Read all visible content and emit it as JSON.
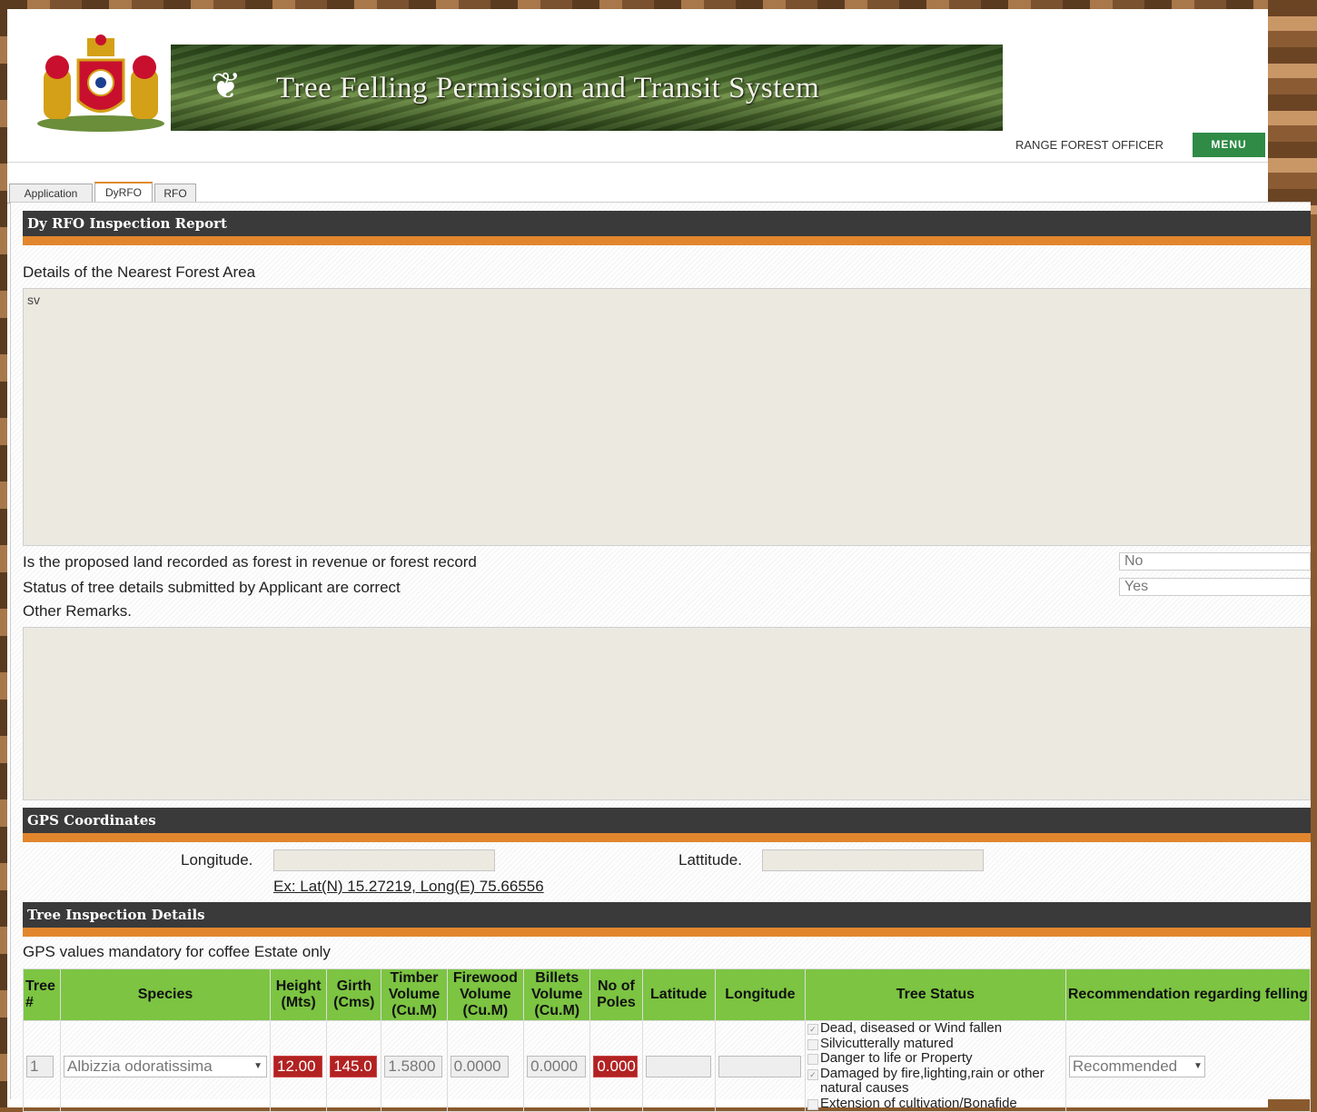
{
  "header": {
    "banner_title": "Tree Felling Permission and Transit System",
    "role": "RANGE FOREST OFFICER",
    "menu_label": "MENU"
  },
  "tabs": [
    {
      "label": "Application"
    },
    {
      "label": "DyRFO"
    },
    {
      "label": "RFO"
    }
  ],
  "inspection": {
    "section_title": "Dy RFO Inspection Report",
    "nearest_forest_label": "Details of the Nearest Forest Area",
    "nearest_forest_value": "sv",
    "land_recorded_label": "Is the proposed land recorded as forest in revenue or forest record",
    "land_recorded_value": "No",
    "tree_details_label": "Status of tree details submitted by Applicant are correct",
    "tree_details_value": "Yes",
    "other_remarks_label": "Other Remarks.",
    "other_remarks_value": ""
  },
  "gps": {
    "section_title": "GPS Coordinates",
    "longitude_label": "Longitude.",
    "latitude_label": "Lattitude.",
    "example": "Ex: Lat(N) 15.27219, Long(E) 75.66556"
  },
  "tree_inspection": {
    "section_title": "Tree Inspection Details",
    "note": "GPS values mandatory for coffee Estate only",
    "columns": {
      "tree_no": "Tree #",
      "species": "Species",
      "height": "Height (Mts)",
      "girth": "Girth (Cms)",
      "timber": "Timber Volume (Cu.M)",
      "firewood": "Firewood Volume (Cu.M)",
      "billets": "Billets Volume (Cu.M)",
      "poles": "No of Poles",
      "latitude": "Latitude",
      "longitude": "Longitude",
      "status": "Tree Status",
      "recommendation": "Recommendation regarding felling"
    },
    "rows": [
      {
        "tree_no": "1",
        "species": "Albizzia odoratissima",
        "height": "12.00",
        "girth": "145.0",
        "timber": "1.5800",
        "firewood": "0.0000",
        "billets": "0.0000",
        "poles": "0.000",
        "latitude": "",
        "longitude": "",
        "status_options": [
          {
            "label": "Dead, diseased or Wind fallen",
            "checked": true
          },
          {
            "label": "Silvicutterally matured",
            "checked": false
          },
          {
            "label": "Danger to life or Property",
            "checked": false
          },
          {
            "label": "Damaged by fire,lighting,rain or other natural causes",
            "checked": true
          },
          {
            "label": "Extension of cultivation/Bonafide",
            "checked": false
          }
        ],
        "recommendation": "Recommended"
      }
    ]
  },
  "colors": {
    "section_header": "#3a3a3a",
    "accent_orange": "#e2862e",
    "table_header_green": "#7cc442",
    "menu_green": "#2f8b45",
    "invalid_red": "#b22222"
  }
}
